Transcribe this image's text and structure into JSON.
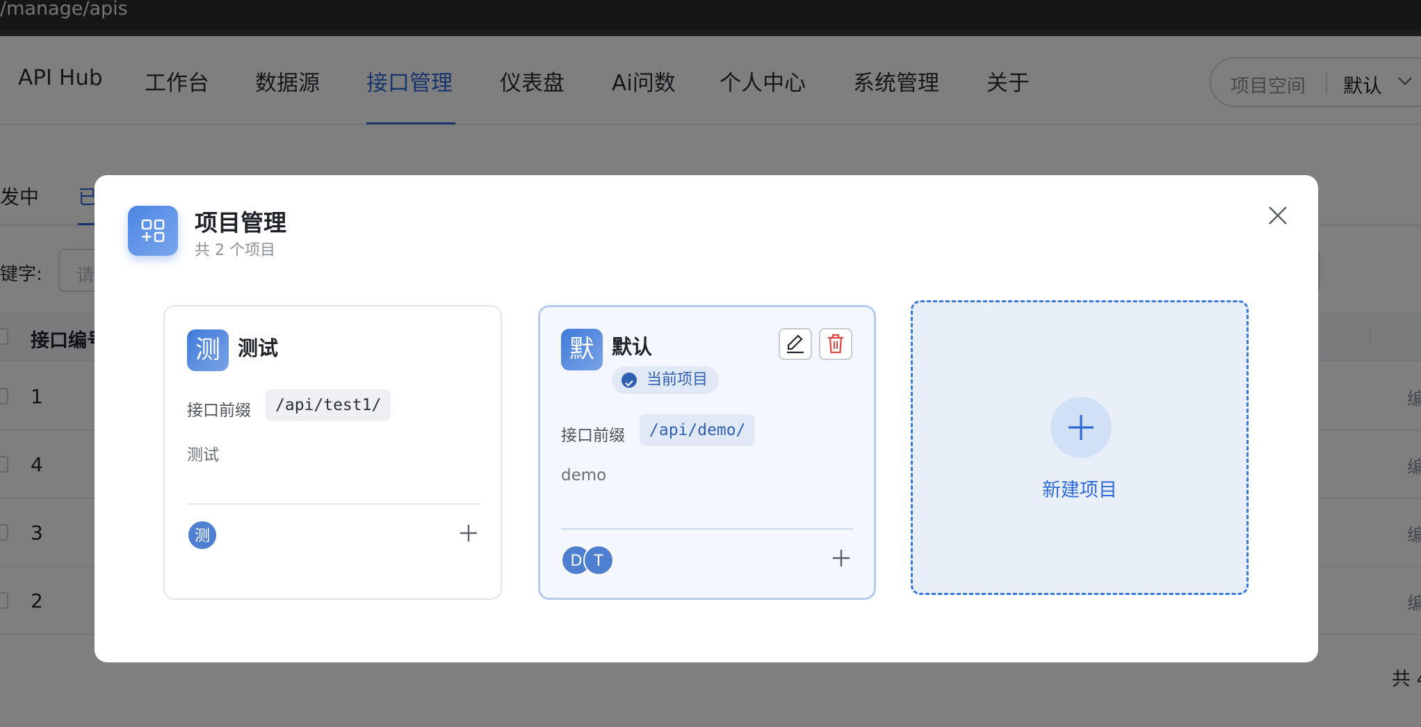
{
  "browser": {
    "url": "/manage/apis"
  },
  "nav": {
    "items": [
      "API Hub",
      "工作台",
      "数据源",
      "接口管理",
      "仪表盘",
      "Ai问数",
      "个人中心",
      "系统管理",
      "关于"
    ],
    "active": "接口管理",
    "workspace_label": "项目空间",
    "workspace_value": "默认"
  },
  "page": {
    "tabs": [
      "发中",
      "已"
    ],
    "keyword_label": "键字:",
    "keyword_placeholder": "请",
    "column_header": "接口编号",
    "rows": [
      "1",
      "4",
      "3",
      "2"
    ],
    "edit_label": "编",
    "total_label": "共 4"
  },
  "modal": {
    "title": "项目管理",
    "subtitle": "共 2 个项目",
    "prefix_label": "接口前缀",
    "projects": [
      {
        "avatar": "测",
        "name": "测试",
        "prefix": "/api/test1/",
        "description": "测试",
        "members": [
          "测"
        ],
        "current": false
      },
      {
        "avatar": "默",
        "name": "默认",
        "prefix": "/api/demo/",
        "description": "demo",
        "members": [
          "D",
          "T"
        ],
        "current": true,
        "current_label": "当前项目"
      }
    ],
    "new_project_label": "新建项目"
  },
  "colors": {
    "accent": "#2f6bd8",
    "delete": "#e0443e",
    "current_border": "#b5ccef"
  }
}
